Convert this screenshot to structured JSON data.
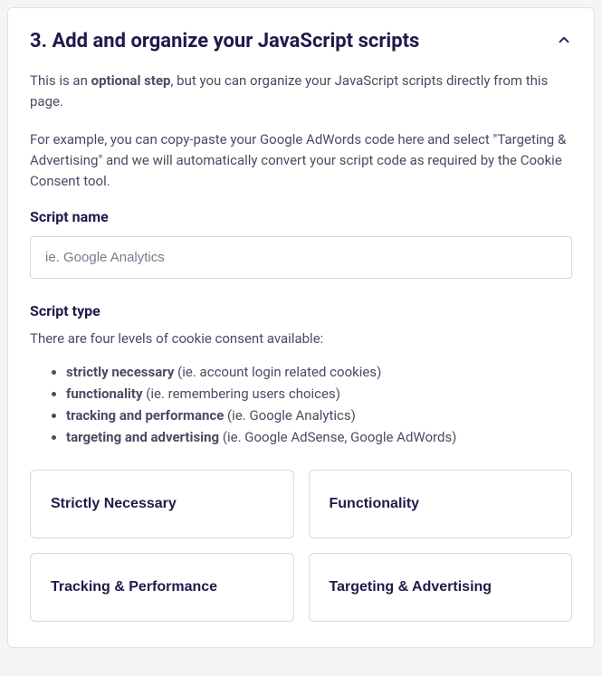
{
  "header": {
    "title": "3. Add and organize your JavaScript scripts"
  },
  "intro": {
    "prefix": "This is an ",
    "bold": "optional step",
    "rest": ", but you can organize your JavaScript scripts directly from this page."
  },
  "example": "For example, you can copy-paste your Google AdWords code here and select \"Targeting & Advertising\" and we will automatically convert your script code as required by the Cookie Consent tool.",
  "scriptName": {
    "label": "Script name",
    "placeholder": "ie. Google Analytics"
  },
  "scriptType": {
    "label": "Script type",
    "helper": "There are four levels of cookie consent available:",
    "levels": [
      {
        "term": "strictly necessary",
        "desc": " (ie. account login related cookies)"
      },
      {
        "term": "functionality",
        "desc": " (ie. remembering users choices)"
      },
      {
        "term": "tracking and performance",
        "desc": " (ie. Google Analytics)"
      },
      {
        "term": "targeting and advertising",
        "desc": " (ie. Google AdSense, Google AdWords)"
      }
    ],
    "options": [
      "Strictly Necessary",
      "Functionality",
      "Tracking & Performance",
      "Targeting & Advertising"
    ]
  }
}
